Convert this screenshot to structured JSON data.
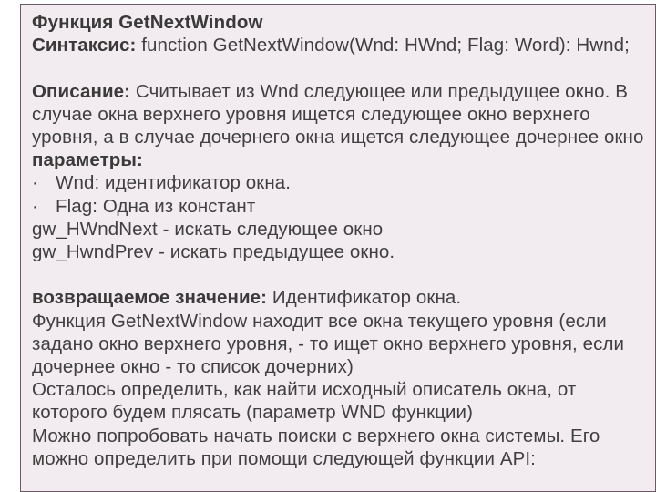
{
  "title_label": "Функция",
  "title_name": "GetNextWindow",
  "syntax_label": "Синтаксис:",
  "syntax_value": "function GetNextWindow(Wnd: HWnd; Flag: Word): Hwnd;",
  "desc_label": "Описание:",
  "desc_line1_rest": "Считывает из Wnd следующее или предыдущее окно. В",
  "desc_line2": "случае окна верхнего уровня ищется следующее окно верхнего",
  "desc_line3": "уровня, а в случае дочернего окна ищется следующее дочернее окно",
  "params_label": "параметры:",
  "bullet1": "Wnd: идентификатор окна.",
  "bullet2": "Flag: Одна из констант",
  "const1": "gw_HWndNext - искать следующее окно",
  "const2": "gw_HwndPrev - искать предыдущее окно.",
  "ret_label": "возвращаемое значение:",
  "ret_rest": "Идентификатор окна.",
  "para1": "Функция GetNextWindow находит все окна текущего уровня (если",
  "para2": "задано окно верхнего уровня, - то ищет окно верхнего уровня, если",
  "para3": "дочернее окно - то список дочерних)",
  "para4": "Осталось определить, как найти исходный описатель окна, от",
  "para5": "которого будем плясать (параметр WND функции)",
  "para6": "Можно попробовать начать поиски с верхнего окна системы. Его",
  "para7": "можно определить при помощи следующей функции API:",
  "dot": "·"
}
